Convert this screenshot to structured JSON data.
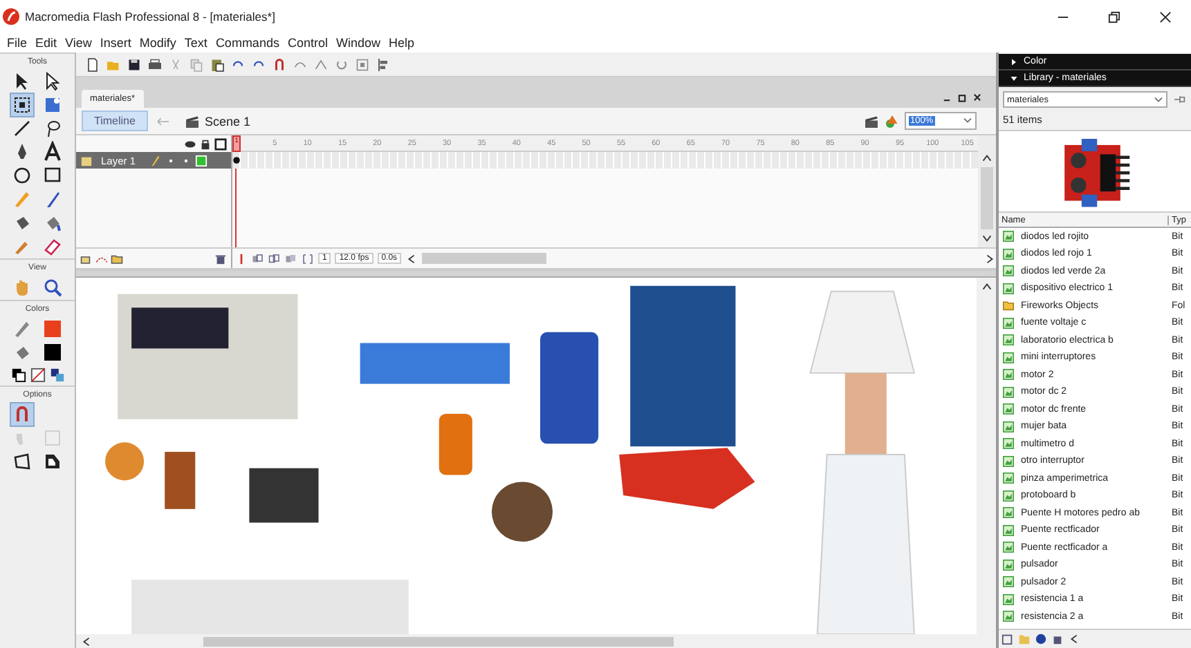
{
  "window": {
    "title": "Macromedia Flash Professional 8 - [materiales*]"
  },
  "menu": [
    "File",
    "Edit",
    "View",
    "Insert",
    "Modify",
    "Text",
    "Commands",
    "Control",
    "Window",
    "Help"
  ],
  "tools_panel": {
    "title": "Tools",
    "view_title": "View",
    "colors_title": "Colors",
    "options_title": "Options",
    "tools": [
      {
        "selected": false
      },
      {
        "selected": false
      },
      {
        "selected": true
      },
      {
        "selected": false
      },
      {
        "selected": false
      },
      {
        "selected": false
      },
      {
        "selected": false
      },
      {
        "selected": false
      },
      {
        "selected": false
      },
      {
        "selected": false
      },
      {
        "selected": false
      },
      {
        "selected": false
      },
      {
        "selected": false
      },
      {
        "selected": false
      },
      {
        "selected": false
      },
      {
        "selected": false
      }
    ],
    "snap_on": true
  },
  "document": {
    "tab": "materiales*",
    "timeline_button": "Timeline",
    "scene": "Scene 1",
    "zoom": "100%",
    "playhead": "1",
    "frame_numbers": [
      "5",
      "10",
      "15",
      "20",
      "25",
      "30",
      "35",
      "40",
      "45",
      "50",
      "55",
      "60",
      "65",
      "70",
      "75",
      "80",
      "85",
      "90",
      "95",
      "100",
      "105"
    ],
    "layers": [
      {
        "name": "Layer 1",
        "selected": true
      }
    ],
    "current_frame": "1",
    "frame_rate": "12.0 fps",
    "elapsed": "0.0s"
  },
  "panels": {
    "color": {
      "title": "Color",
      "expanded": false
    },
    "library": {
      "title": "Library - materiales",
      "expanded": true,
      "source": "materiales",
      "count": "51 items",
      "columns": [
        "Name",
        "Typ"
      ],
      "items": [
        {
          "name": "diodos led rojito",
          "type": "Bit",
          "kind": "bitmap"
        },
        {
          "name": "diodos led rojo 1",
          "type": "Bit",
          "kind": "bitmap"
        },
        {
          "name": "diodos led verde 2a",
          "type": "Bit",
          "kind": "bitmap"
        },
        {
          "name": "dispositivo electrico 1",
          "type": "Bit",
          "kind": "bitmap"
        },
        {
          "name": "Fireworks Objects",
          "type": "Fol",
          "kind": "folder"
        },
        {
          "name": "fuente voltaje c",
          "type": "Bit",
          "kind": "bitmap"
        },
        {
          "name": "laboratorio electrica b",
          "type": "Bit",
          "kind": "bitmap"
        },
        {
          "name": "mini interruptores",
          "type": "Bit",
          "kind": "bitmap"
        },
        {
          "name": "motor 2",
          "type": "Bit",
          "kind": "bitmap"
        },
        {
          "name": "motor dc 2",
          "type": "Bit",
          "kind": "bitmap"
        },
        {
          "name": "motor dc frente",
          "type": "Bit",
          "kind": "bitmap"
        },
        {
          "name": "mujer bata",
          "type": "Bit",
          "kind": "bitmap"
        },
        {
          "name": "multimetro d",
          "type": "Bit",
          "kind": "bitmap"
        },
        {
          "name": "otro interruptor",
          "type": "Bit",
          "kind": "bitmap"
        },
        {
          "name": "pinza amperimetrica",
          "type": "Bit",
          "kind": "bitmap"
        },
        {
          "name": "protoboard b",
          "type": "Bit",
          "kind": "bitmap"
        },
        {
          "name": "Puente H motores pedro ab",
          "type": "Bit",
          "kind": "bitmap"
        },
        {
          "name": "Puente rectficador",
          "type": "Bit",
          "kind": "bitmap"
        },
        {
          "name": "Puente rectficador a",
          "type": "Bit",
          "kind": "bitmap"
        },
        {
          "name": "pulsador",
          "type": "Bit",
          "kind": "bitmap"
        },
        {
          "name": "pulsador 2",
          "type": "Bit",
          "kind": "bitmap"
        },
        {
          "name": "resistencia 1 a",
          "type": "Bit",
          "kind": "bitmap"
        },
        {
          "name": "resistencia 2 a",
          "type": "Bit",
          "kind": "bitmap"
        }
      ]
    }
  }
}
